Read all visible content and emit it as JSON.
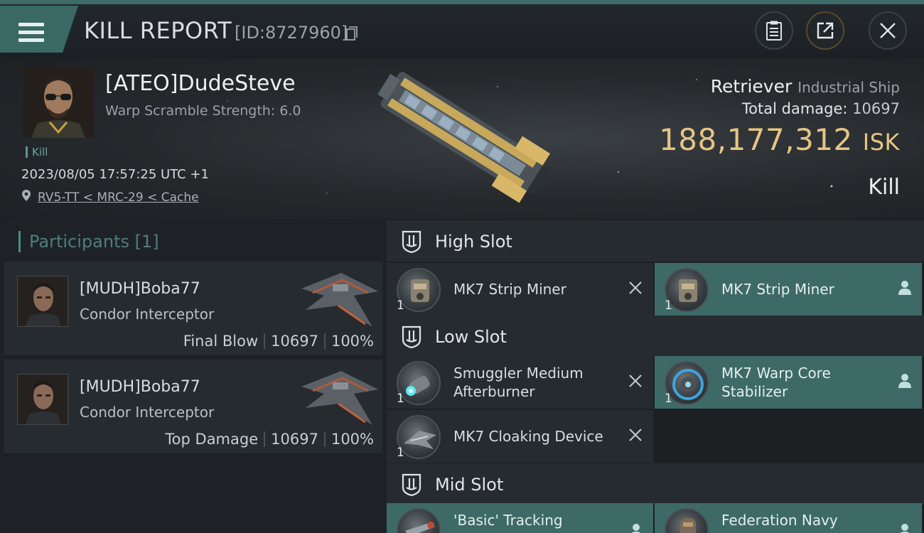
{
  "header": {
    "title": "KILL REPORT",
    "report_id": "[ID:8727960]",
    "icons": [
      "menu-icon",
      "clipboard-icon",
      "share-icon",
      "close-icon"
    ]
  },
  "victim": {
    "name": "[ATEO]DudeSteve",
    "warp_scramble": "Warp Scramble Strength: 6.0",
    "tag": "Kill",
    "datetime": "2023/08/05 17:57:25 UTC +1",
    "location": "RV5-TT < MRC-29 < Cache",
    "ship_name": "Retriever",
    "ship_class": "Industrial Ship",
    "damage_label": "Total damage:",
    "damage_value": "10697",
    "isk_value": "188,177,312",
    "isk_unit": "ISK",
    "result": "Kill"
  },
  "participants": {
    "heading": "Participants [1]",
    "rows": [
      {
        "name": "[MUDH]Boba77",
        "ship": "Condor Interceptor",
        "role": "Final Blow",
        "damage": "10697",
        "percent": "100%"
      },
      {
        "name": "[MUDH]Boba77",
        "ship": "Condor Interceptor",
        "role": "Top Damage",
        "damage": "10697",
        "percent": "100%"
      }
    ]
  },
  "slots": {
    "high": {
      "title": "High Slot",
      "modules": [
        {
          "name": "MK7 Strip Miner",
          "qty": "1",
          "status": "destroyed"
        },
        {
          "name": "MK7 Strip Miner",
          "qty": "1",
          "status": "dropped"
        }
      ]
    },
    "low": {
      "title": "Low Slot",
      "modules": [
        {
          "name_line1": "Smuggler Medium",
          "name_line2": "Afterburner",
          "qty": "1",
          "status": "destroyed"
        },
        {
          "name_line1": "MK7 Warp Core",
          "name_line2": "Stabilizer",
          "qty": "1",
          "status": "dropped"
        },
        {
          "name": "MK7 Cloaking Device",
          "qty": "1",
          "status": "destroyed"
        }
      ]
    },
    "mid": {
      "title": "Mid Slot",
      "modules": [
        {
          "name": "'Basic' Tracking",
          "status": "dropped"
        },
        {
          "name": "Federation Navy",
          "status": "dropped"
        }
      ]
    }
  },
  "colors": {
    "accent": "#3d6a67",
    "isk": "#e6c583",
    "background": "#1a1e22"
  }
}
